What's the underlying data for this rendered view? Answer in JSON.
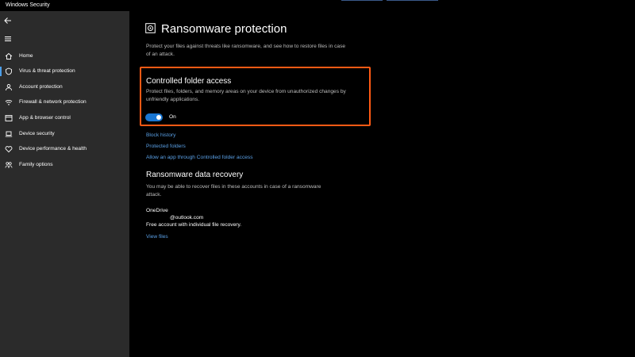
{
  "window": {
    "title": "Windows Security"
  },
  "sidebar": {
    "items": [
      {
        "label": "Home",
        "icon": "home-icon"
      },
      {
        "label": "Virus & threat protection",
        "icon": "shield-icon",
        "active": true
      },
      {
        "label": "Account protection",
        "icon": "person-icon"
      },
      {
        "label": "Firewall & network protection",
        "icon": "wifi-icon"
      },
      {
        "label": "App & browser control",
        "icon": "app-window-icon"
      },
      {
        "label": "Device security",
        "icon": "laptop-icon"
      },
      {
        "label": "Device performance & health",
        "icon": "heart-icon"
      },
      {
        "label": "Family options",
        "icon": "family-icon"
      }
    ]
  },
  "page": {
    "title": "Ransomware protection",
    "description": "Protect your files against threats like ransomware, and see how to restore files in case of an attack."
  },
  "cfa": {
    "heading": "Controlled folder access",
    "description": "Protect files, folders, and memory areas on your device from unauthorized changes by unfriendly applications.",
    "toggle_label": "On",
    "enabled": true
  },
  "links": {
    "block_history": "Block history",
    "protected_folders": "Protected folders",
    "allow_app": "Allow an app through Controlled folder access"
  },
  "recovery": {
    "heading": "Ransomware data recovery",
    "description": "You may be able to recover files in these accounts in case of a ransomware attack.",
    "provider": "OneDrive",
    "account": "@outlook.com",
    "plan": "Free account with individual file recovery.",
    "view_files": "View files"
  },
  "colors": {
    "accent": "#1976d2",
    "link": "#5aa0e6",
    "highlight": "#ff5a14",
    "sidebar": "#2b2b2b"
  }
}
